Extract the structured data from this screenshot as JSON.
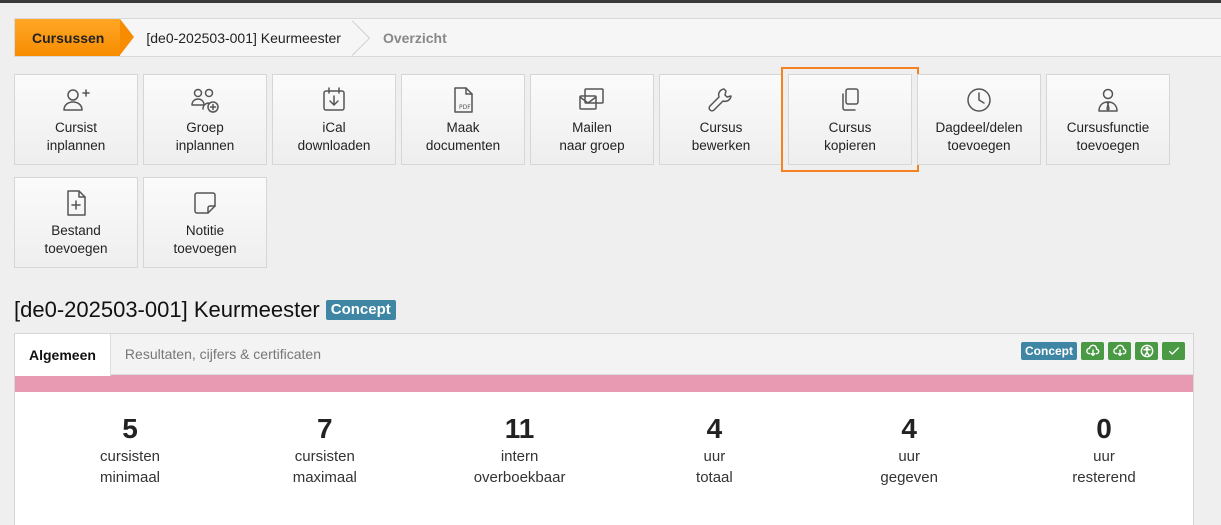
{
  "breadcrumb": {
    "home": "Cursussen",
    "course": "[de0-202503-001] Keurmeester",
    "current": "Overzicht"
  },
  "toolbar": {
    "row1": [
      {
        "icon": "user-plus-icon",
        "l1": "Cursist",
        "l2": "inplannen"
      },
      {
        "icon": "users-plus-icon",
        "l1": "Groep",
        "l2": "inplannen"
      },
      {
        "icon": "calendar-download-icon",
        "l1": "iCal",
        "l2": "downloaden"
      },
      {
        "icon": "pdf-document-icon",
        "l1": "Maak",
        "l2": "documenten"
      },
      {
        "icon": "mail-group-icon",
        "l1": "Mailen",
        "l2": "naar groep"
      },
      {
        "icon": "wrench-icon",
        "l1": "Cursus",
        "l2": "bewerken"
      },
      {
        "icon": "copy-icon",
        "l1": "Cursus",
        "l2": "kopieren"
      },
      {
        "icon": "clock-icon",
        "l1": "Dagdeel/delen",
        "l2": "toevoegen"
      },
      {
        "icon": "user-tie-icon",
        "l1": "Cursusfunctie",
        "l2": "toevoegen"
      }
    ],
    "row2": [
      {
        "icon": "file-plus-icon",
        "l1": "Bestand",
        "l2": "toevoegen"
      },
      {
        "icon": "note-icon",
        "l1": "Notitie",
        "l2": "toevoegen"
      }
    ]
  },
  "page": {
    "title": "[de0-202503-001] Keurmeester",
    "status_badge": "Concept"
  },
  "tabs": [
    "Algemeen",
    "Resultaten, cijfers & certificaten"
  ],
  "status_icons": {
    "badge": "Concept",
    "buttons": [
      "cloud-download-icon",
      "cloud-download-icon",
      "accessibility-icon",
      "check-icon"
    ],
    "color": "#4a9a45"
  },
  "colors": {
    "accent": "#f78c00",
    "badge": "#3f86a5",
    "pink_bar": "#e79ab1",
    "selection": "#f58220"
  },
  "stats": [
    {
      "value": "5",
      "l1": "cursisten",
      "l2": "minimaal"
    },
    {
      "value": "7",
      "l1": "cursisten",
      "l2": "maximaal"
    },
    {
      "value": "11",
      "l1": "intern",
      "l2": "overboekbaar"
    },
    {
      "value": "4",
      "l1": "uur",
      "l2": "totaal"
    },
    {
      "value": "4",
      "l1": "uur",
      "l2": "gegeven"
    },
    {
      "value": "0",
      "l1": "uur",
      "l2": "resterend"
    }
  ]
}
